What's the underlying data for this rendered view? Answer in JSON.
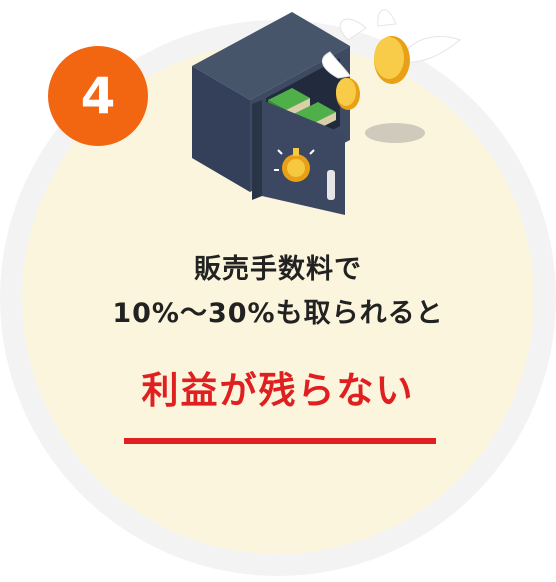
{
  "badge": {
    "number": "4",
    "color": "#f26511"
  },
  "message": {
    "line1": "販売手数料で",
    "line2": "10%〜30%も取られると",
    "highlight": "利益が残らない"
  },
  "illustration": {
    "name": "safe-with-flying-coins-icon"
  },
  "colors": {
    "circle_fill": "#faf5dc",
    "ring": "#f3f3f3",
    "highlight": "#e02020",
    "text": "#222222"
  }
}
